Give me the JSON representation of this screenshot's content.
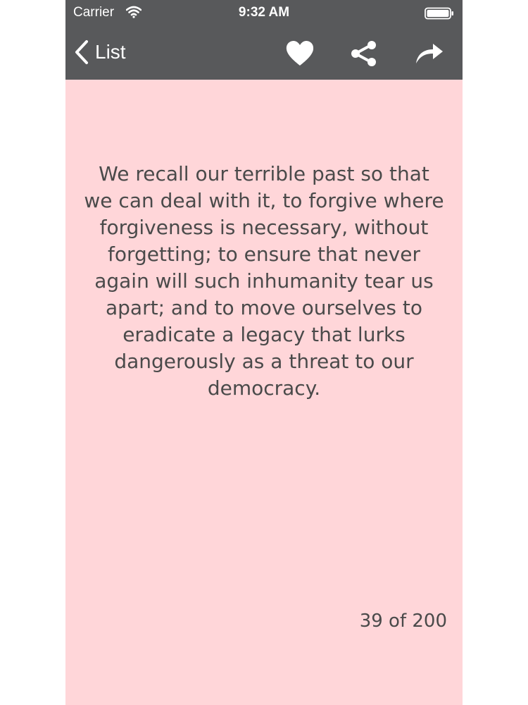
{
  "status_bar": {
    "carrier": "Carrier",
    "time": "9:32 AM"
  },
  "nav": {
    "back_label": "List",
    "icons": [
      "heart-icon",
      "share-icon",
      "forward-icon"
    ]
  },
  "quote": {
    "text": "We recall our terrible past so that we can deal with it, to forgive where forgiveness is necessary, without forgetting; to ensure that never again will such inhumanity tear us apart; and to move ourselves to eradicate a legacy that lurks dangerously as a threat to our democracy."
  },
  "pagination": {
    "label": "39 of 200"
  },
  "colors": {
    "bar": "#58595b",
    "background": "#ffd6d9",
    "text": "#4a4a4a"
  }
}
